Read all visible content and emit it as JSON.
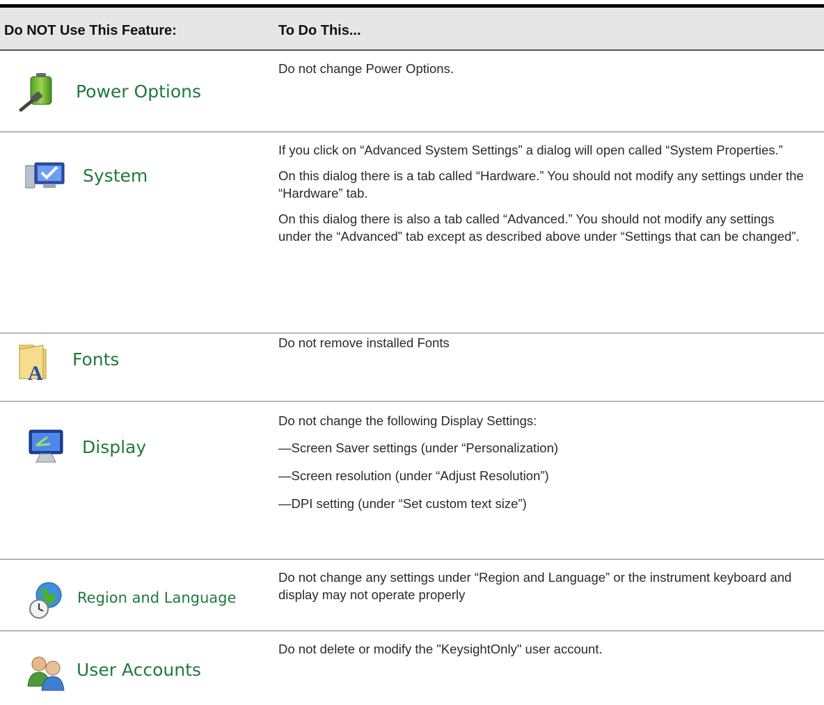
{
  "table": {
    "headers": [
      "Do NOT Use This Feature:",
      "To Do This..."
    ],
    "rows": [
      {
        "feature": "Power Options",
        "icon": "battery-plug-icon",
        "text": [
          "Do not change Power Options."
        ]
      },
      {
        "feature": "System",
        "icon": "computer-checkmark-icon",
        "text": [
          "If you click on “Advanced System Settings” a dialog will open called “System Properties.”",
          "On this dialog there is a tab called “Hardware.” You should not modify any settings under the “Hardware” tab.",
          "On this dialog there is also a tab called “Advanced.” You should not modify any settings under the “Advanced” tab except as described above under “Settings that can be changed”."
        ]
      },
      {
        "feature": "Fonts",
        "icon": "font-folder-icon",
        "text": [
          "Do not remove installed Fonts"
        ]
      },
      {
        "feature": "Display",
        "icon": "monitor-icon",
        "text": [
          "Do not change the following Display Settings:",
          "—Screen Saver settings (under “Personalization)",
          "—Screen resolution (under “Adjust Resolution”)",
          "—DPI setting (under “Set custom text size”)"
        ]
      },
      {
        "feature": "Region and Language",
        "icon": "globe-clock-icon",
        "text": [
          "Do not change any settings under “Region and Language” or the instrument keyboard and display may not operate properly"
        ]
      },
      {
        "feature": "User Accounts",
        "icon": "users-icon",
        "text": [
          "Do not delete or modify the \"KeysightOnly\" user account."
        ]
      }
    ]
  }
}
